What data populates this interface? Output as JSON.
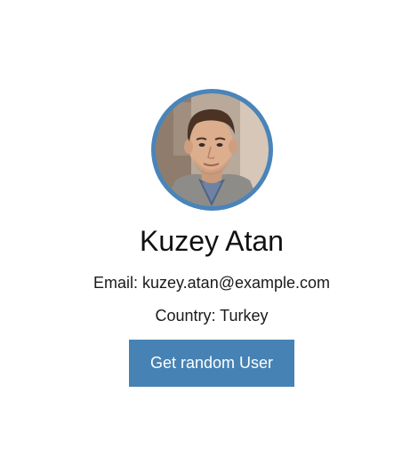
{
  "profile": {
    "name": "Kuzey Atan",
    "email_label": "Email: kuzey.atan@example.com",
    "country_label": "Country: Turkey",
    "avatar_icon": "user-photo"
  },
  "actions": {
    "random_button_label": "Get random User"
  },
  "colors": {
    "accent": "#4682b4",
    "avatar_ring": "#4a84b8"
  }
}
